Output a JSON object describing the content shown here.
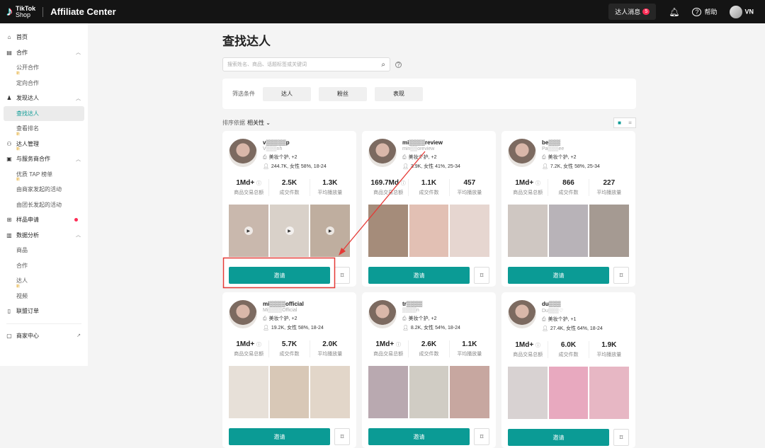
{
  "header": {
    "brand_top": "TikTok",
    "brand_bottom": "Shop",
    "title": "Affiliate Center",
    "messages_label": "达人消息",
    "messages_count": "5",
    "help_label": "帮助",
    "user": "VN"
  },
  "sidebar": {
    "items": [
      {
        "label": "首页",
        "icon": "⌂",
        "level": 0
      },
      {
        "label": "合作",
        "icon": "▤",
        "level": 0,
        "chevron": true
      },
      {
        "label": "公开合作",
        "level": 1,
        "new": "新"
      },
      {
        "label": "定向合作",
        "level": 1
      },
      {
        "label": "发现达人",
        "icon": "♟",
        "level": 0,
        "chevron": true
      },
      {
        "label": "查找达人",
        "level": 1,
        "active": true
      },
      {
        "label": "查看排名",
        "level": 1,
        "new": "新"
      },
      {
        "label": "达人管理",
        "icon": "⚇",
        "level": 0,
        "new": "新"
      },
      {
        "label": "与服务商合作",
        "icon": "▣",
        "level": 0,
        "chevron": true
      },
      {
        "label": "优质 TAP 榜单",
        "level": 1,
        "new": "新"
      },
      {
        "label": "由商家发起的活动",
        "level": 1
      },
      {
        "label": "由团长发起的活动",
        "level": 1
      },
      {
        "label": "样品申请",
        "icon": "⊞",
        "level": 0,
        "dot": true
      },
      {
        "label": "数据分析",
        "icon": "▥",
        "level": 0,
        "chevron": true
      },
      {
        "label": "商品",
        "level": 1
      },
      {
        "label": "合作",
        "level": 1
      },
      {
        "label": "达人",
        "level": 1,
        "new": "新"
      },
      {
        "label": "视频",
        "level": 1
      },
      {
        "label": "联盟订单",
        "icon": "▯",
        "level": 0
      }
    ],
    "footer": {
      "label": "商家中心",
      "icon": "▢"
    }
  },
  "page": {
    "title": "查找达人",
    "search_placeholder": "搜索姓名、商品、话题标签或关键词",
    "filter_label": "筛选条件",
    "filters": [
      "达人",
      "粉丝",
      "表现"
    ],
    "sort_label": "排序依据",
    "sort_value": "相关性"
  },
  "stat_labels": [
    "商品交易总额",
    "成交件数",
    "平均播放量"
  ],
  "invite_label": "邀请",
  "creators": [
    {
      "name": "v▒▒▒▒▒p",
      "handle": "V▒▒▒nh",
      "category": "美妆个护, +2",
      "audience": "244.7K, 女性 58%, 18-24",
      "gmv": "1Md+",
      "units": "2.5K",
      "views": "1.3K"
    },
    {
      "name": "mi▒▒▒▒review",
      "handle": "min▒▒oreview",
      "category": "美妆个护, +2",
      "audience": "3.9K, 女性 41%, 25-34",
      "gmv": "169.7Md",
      "units": "1.1K",
      "views": "457"
    },
    {
      "name": "be▒▒▒",
      "handle": "Pa▒▒▒ee",
      "category": "美妆个护, +2",
      "audience": "7.2K, 女性 58%, 25-34",
      "gmv": "1Md+",
      "units": "866",
      "views": "227"
    },
    {
      "name": "mi▒▒▒▒official",
      "handle": "Mi▒▒▒▒Official",
      "category": "美妆个护, +2",
      "audience": "19.2K, 女性 58%, 18-24",
      "gmv": "1Md+",
      "units": "5.7K",
      "views": "2.0K"
    },
    {
      "name": "tr▒▒▒▒",
      "handle": "▒▒▒▒n",
      "category": "美妆个护, +2",
      "audience": "8.2K, 女性 54%, 18-24",
      "gmv": "1Md+",
      "units": "2.6K",
      "views": "1.1K"
    },
    {
      "name": "du▒▒▒",
      "handle": "Du▒▒▒♡",
      "category": "美妆个护, +1",
      "audience": "27.4K, 女性 64%, 18-24",
      "gmv": "1Md+",
      "units": "6.0K",
      "views": "1.9K"
    }
  ],
  "colors": {
    "accent": "#0b9b95",
    "annotation": "#e53935"
  }
}
